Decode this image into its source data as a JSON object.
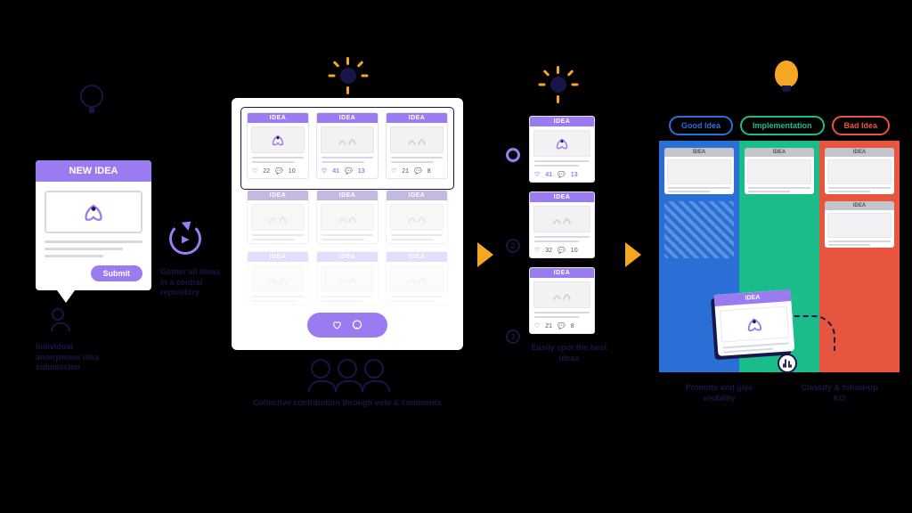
{
  "common": {
    "idea_label": "IDEA"
  },
  "stage1": {
    "header": "NEW IDEA",
    "submit": "Submit",
    "caption": "Individual anonymous idea submission"
  },
  "cycle": {
    "caption": "Gather all ideas in a central repository"
  },
  "stage2": {
    "cards": [
      {
        "likes": 22,
        "comments": 10,
        "hl": false
      },
      {
        "likes": 41,
        "comments": 13,
        "hl": true
      },
      {
        "likes": 21,
        "comments": 8,
        "hl": false
      }
    ],
    "caption": "Collective contribution through vote & comments"
  },
  "stage3": {
    "ranked": [
      {
        "likes": 41,
        "comments": 13,
        "hl": true
      },
      {
        "likes": 32,
        "comments": 10,
        "hl": false
      },
      {
        "likes": 21,
        "comments": 8,
        "hl": false
      }
    ],
    "caption": "Easily spot the best ideas"
  },
  "stage4": {
    "tabs": {
      "blue": "Good Idea",
      "green": "Implementation",
      "red": "Bad Idea"
    },
    "caption_left": "Promote and give visibility",
    "caption_right": "Classify & follow-up KO"
  }
}
